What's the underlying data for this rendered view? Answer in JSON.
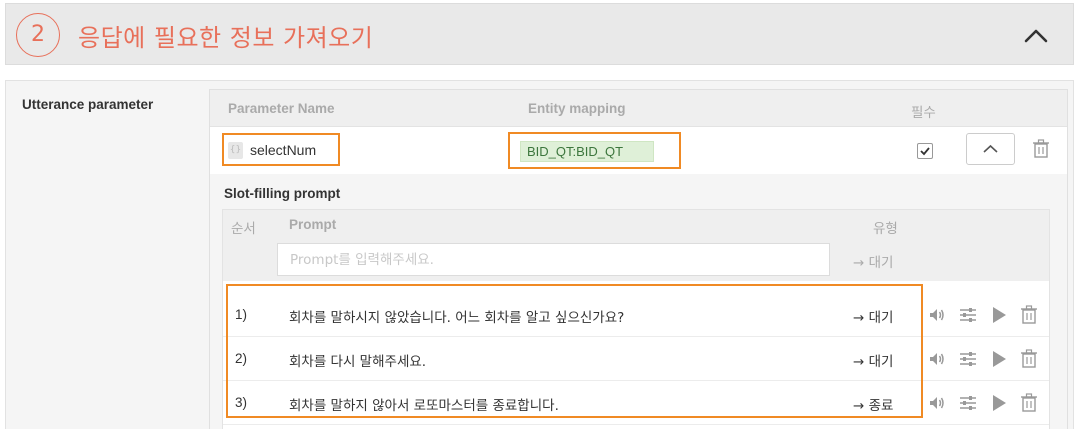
{
  "section": {
    "step_number": "2",
    "title": "응답에 필요한 정보 가져오기",
    "collapse_icon": "chevron-up-icon"
  },
  "utterance": {
    "label": "Utterance parameter",
    "columns": {
      "name": "Parameter Name",
      "entity": "Entity mapping",
      "required": "필수"
    },
    "parameter": {
      "icon": "variable-icon",
      "icon_glyph": "{}",
      "name": "selectNum",
      "entity": "BID_QT:BID_QT",
      "required": true
    }
  },
  "slot_filling": {
    "title": "Slot-filling prompt",
    "columns": {
      "order": "순서",
      "prompt": "Prompt",
      "type": "유형"
    },
    "input": {
      "placeholder": "Prompt를 입력해주세요.",
      "type": "→ 대기"
    },
    "rows": [
      {
        "num": "1)",
        "text": "회차를 말하시지 않았습니다. 어느 회차를 알고 싶으신가요?",
        "type": "→ 대기"
      },
      {
        "num": "2)",
        "text": "회차를 다시 말해주세요.",
        "type": "→ 대기"
      },
      {
        "num": "3)",
        "text": "회차를 말하지 않아서 로또마스터를 종료합니다.",
        "type": "→ 종료"
      }
    ]
  },
  "colors": {
    "accent": "#e8705a",
    "highlight_border": "#f08a24",
    "entity_bg": "#dff0d8"
  }
}
